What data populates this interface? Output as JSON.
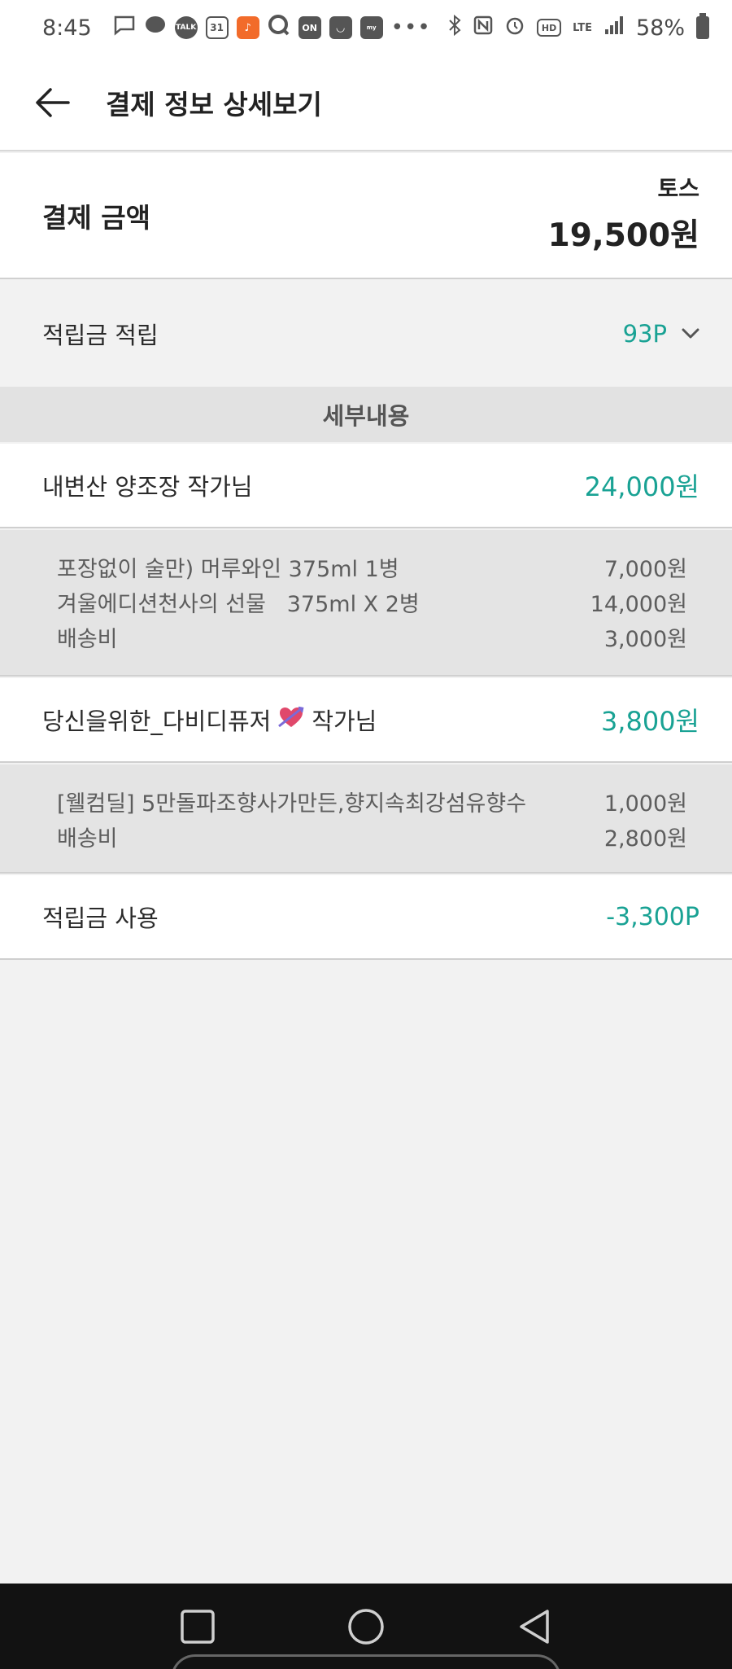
{
  "status_bar": {
    "time": "8:45",
    "left_icons": [
      "message-icon",
      "chat-bubble-icon",
      "talk-icon",
      "calendar-icon",
      "tiktok-icon",
      "q-icon",
      "on-icon",
      "smile-icon",
      "homeplus-icon"
    ],
    "talk_label": "TALK",
    "calendar_label": "31",
    "on_label": "ON",
    "more": "•••",
    "right_icons": [
      "bluetooth-icon",
      "nfc-icon",
      "alarm-icon",
      "hd-icon",
      "lte-icon",
      "signal-icon",
      "battery-icon"
    ],
    "hd_label": "HD",
    "lte_label": "LTE",
    "battery": "58%"
  },
  "app_bar": {
    "title": "결제 정보 상세보기"
  },
  "summary": {
    "label": "결제 금액",
    "method": "토스",
    "amount": "19,500원"
  },
  "points_earn": {
    "label": "적립금 적립",
    "value": "93P"
  },
  "detail_header": "세부내용",
  "sellers": [
    {
      "name": "내변산 양조장 작가님",
      "total": "24,000원",
      "items": [
        {
          "name": "포장없이 술만) 머루와인 375ml 1병",
          "price": "7,000원"
        },
        {
          "name": "겨울에디션천사의 선물   375ml X 2병",
          "price": "14,000원"
        },
        {
          "name": "배송비",
          "price": "3,000원"
        }
      ]
    },
    {
      "name": "당신을위한_다비디퓨저",
      "name_suffix": "작가님",
      "total": "3,800원",
      "items": [
        {
          "name": "[웰컴딜] 5만돌파조향사가만든,향지속최강섬유향수",
          "price": "1,000원"
        },
        {
          "name": "배송비",
          "price": "2,800원"
        }
      ]
    }
  ],
  "points_use": {
    "label": "적립금 사용",
    "value": "-3,300P"
  },
  "colors": {
    "accent": "#19a294",
    "detail_bg": "#e4e4e4",
    "page_bg": "#f2f2f2"
  }
}
